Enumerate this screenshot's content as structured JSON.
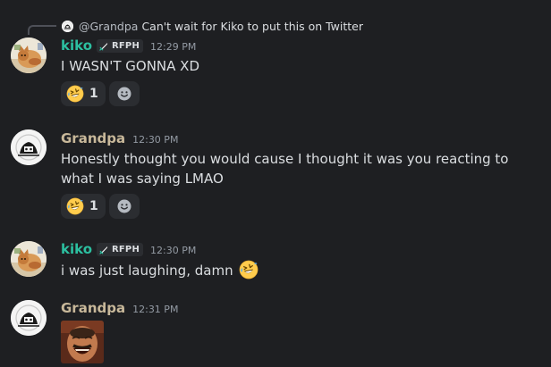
{
  "reply": {
    "author": "@Grandpa",
    "text": "Can't wait for Kiko to put this on Twitter"
  },
  "messages": [
    {
      "author": "kiko",
      "role": "RFPH",
      "time": "12:29 PM",
      "text": "I WASN'T GONNA XD",
      "reaction_emoji": "rofl-emoji",
      "reaction_count": "1"
    },
    {
      "author": "Grandpa",
      "time": "12:30 PM",
      "text": "Honestly thought you would cause I thought it was you reacting to what I was saying LMAO",
      "reaction_emoji": "rofl-emoji",
      "reaction_count": "1"
    },
    {
      "author": "kiko",
      "role": "RFPH",
      "time": "12:30 PM",
      "text": "i was just laughing, damn",
      "inline_emoji": "rofl-emoji"
    },
    {
      "author": "Grandpa",
      "time": "12:31 PM",
      "attachment": "laughing-man-image"
    }
  ],
  "colors": {
    "background": "#1e1f22",
    "kiko_name": "#2cbfa0",
    "grandpa_name": "#c8b89a",
    "reaction_bg": "#2b2d31",
    "timestamp": "#949ba4"
  }
}
